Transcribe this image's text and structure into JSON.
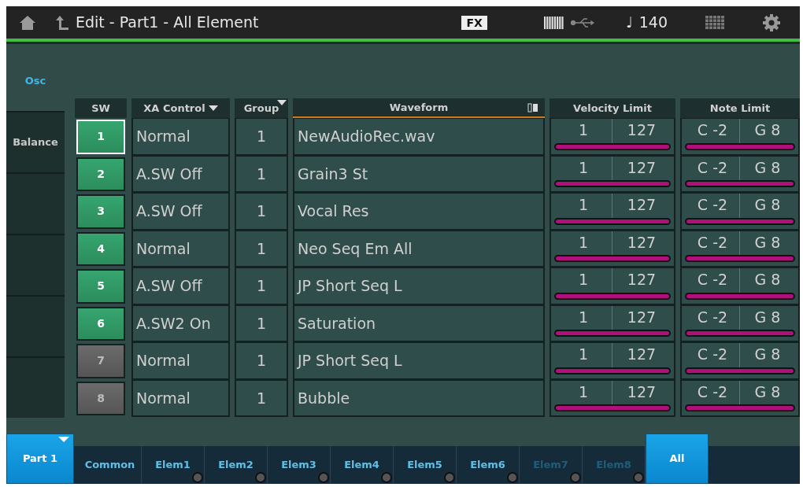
{
  "header": {
    "title": "Edit - Part1 - All Element",
    "fx": "FX",
    "tempo_symbol": "♩",
    "tempo": "140"
  },
  "sidebar": {
    "heading": "Osc",
    "tabs": [
      {
        "label": "Balance",
        "selected": false
      },
      {
        "selected": false
      },
      {
        "selected": false
      },
      {
        "selected": false
      },
      {
        "selected": false
      }
    ]
  },
  "table": {
    "columns": [
      "SW",
      "XA Control",
      "Group",
      "Waveform",
      "Velocity Limit",
      "Note Limit"
    ],
    "rows": [
      {
        "sw": "1",
        "on": true,
        "selected": true,
        "xa": "Normal",
        "group": "1",
        "waveform": "NewAudioRec.wav",
        "vel_low": "1",
        "vel_high": "127",
        "note_low": "C -2",
        "note_high": "G 8"
      },
      {
        "sw": "2",
        "on": true,
        "selected": false,
        "xa": "A.SW Off",
        "group": "1",
        "waveform": "Grain3 St",
        "vel_low": "1",
        "vel_high": "127",
        "note_low": "C -2",
        "note_high": "G 8"
      },
      {
        "sw": "3",
        "on": true,
        "selected": false,
        "xa": "A.SW Off",
        "group": "1",
        "waveform": "Vocal Res",
        "vel_low": "1",
        "vel_high": "127",
        "note_low": "C -2",
        "note_high": "G 8"
      },
      {
        "sw": "4",
        "on": true,
        "selected": false,
        "xa": "Normal",
        "group": "1",
        "waveform": "Neo Seq Em All",
        "vel_low": "1",
        "vel_high": "127",
        "note_low": "C -2",
        "note_high": "G 8"
      },
      {
        "sw": "5",
        "on": true,
        "selected": false,
        "xa": "A.SW Off",
        "group": "1",
        "waveform": "JP Short Seq L",
        "vel_low": "1",
        "vel_high": "127",
        "note_low": "C -2",
        "note_high": "G 8"
      },
      {
        "sw": "6",
        "on": true,
        "selected": false,
        "xa": "A.SW2 On",
        "group": "1",
        "waveform": "Saturation",
        "vel_low": "1",
        "vel_high": "127",
        "note_low": "C -2",
        "note_high": "G 8"
      },
      {
        "sw": "7",
        "on": false,
        "selected": false,
        "xa": "Normal",
        "group": "1",
        "waveform": "JP Short Seq L",
        "vel_low": "1",
        "vel_high": "127",
        "note_low": "C -2",
        "note_high": "G 8"
      },
      {
        "sw": "8",
        "on": false,
        "selected": false,
        "xa": "Normal",
        "group": "1",
        "waveform": "Bubble",
        "vel_low": "1",
        "vel_high": "127",
        "note_low": "C -2",
        "note_high": "G 8"
      }
    ]
  },
  "bottom_tabs": [
    {
      "label": "Part 1",
      "kind": "part",
      "selected": true,
      "disabled": false
    },
    {
      "label": "Common",
      "kind": "tab",
      "selected": false,
      "disabled": false
    },
    {
      "label": "Elem1",
      "kind": "element",
      "selected": false,
      "disabled": false
    },
    {
      "label": "Elem2",
      "kind": "element",
      "selected": false,
      "disabled": false
    },
    {
      "label": "Elem3",
      "kind": "element",
      "selected": false,
      "disabled": false
    },
    {
      "label": "Elem4",
      "kind": "element",
      "selected": false,
      "disabled": false
    },
    {
      "label": "Elem5",
      "kind": "element",
      "selected": false,
      "disabled": false
    },
    {
      "label": "Elem6",
      "kind": "element",
      "selected": false,
      "disabled": false
    },
    {
      "label": "Elem7",
      "kind": "element",
      "selected": false,
      "disabled": true
    },
    {
      "label": "Elem8",
      "kind": "element",
      "selected": false,
      "disabled": true
    },
    {
      "label": "All",
      "kind": "tab",
      "selected": true,
      "disabled": false
    }
  ]
}
